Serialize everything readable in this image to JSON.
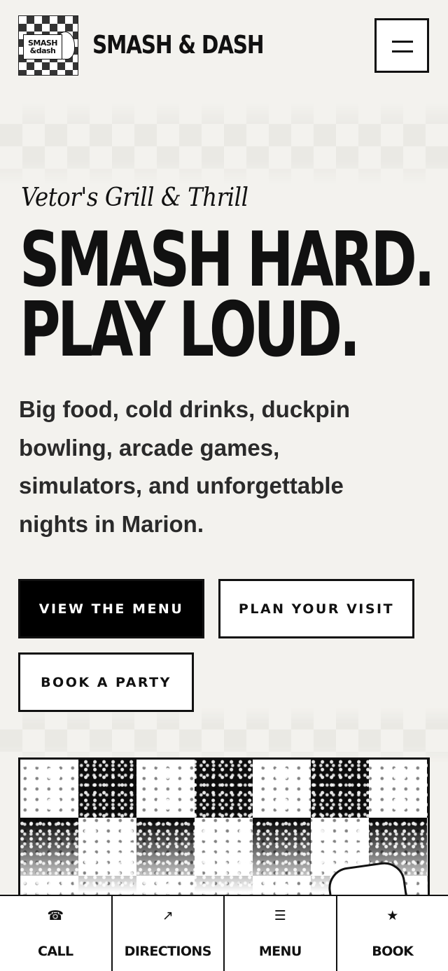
{
  "header": {
    "logo_line1": "SMASH",
    "logo_line2": "&dash",
    "brand": "SMASH & DASH",
    "menu_icon": "hamburger-icon"
  },
  "hero": {
    "eyebrow": "Vetor's Grill & Thrill",
    "headline_line1": "SMASH HARD.",
    "headline_line2": "PLAY LOUD.",
    "intro": "Big food, cold drinks, duckpin bowling, arcade games, simulators, and unforgettable nights in Marion.",
    "buttons": {
      "menu": "VIEW THE MENU",
      "visit": "PLAN YOUR VISIT",
      "party": "BOOK A PARTY"
    }
  },
  "bottom_bar": {
    "items": [
      {
        "icon": "☎",
        "icon_name": "phone-icon",
        "label": "CALL"
      },
      {
        "icon": "↗",
        "icon_name": "arrow-up-right-icon",
        "label": "DIRECTIONS"
      },
      {
        "icon": "☰",
        "icon_name": "menu-list-icon",
        "label": "MENU"
      },
      {
        "icon": "★",
        "icon_name": "star-icon",
        "label": "BOOK"
      }
    ]
  },
  "colors": {
    "background": "#f3f2ee",
    "ink": "#111111",
    "primary_button": "#000000"
  }
}
